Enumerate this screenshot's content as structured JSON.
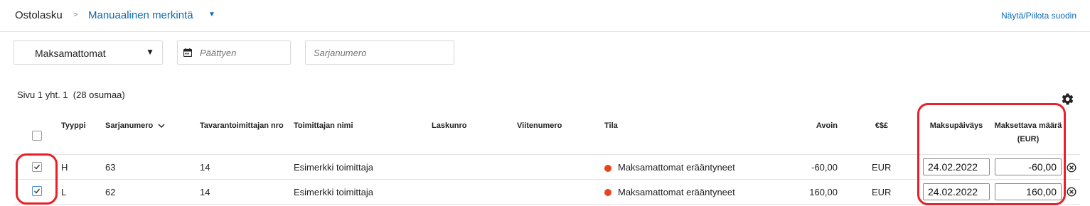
{
  "breadcrumb": {
    "root": "Ostolasku",
    "separator": ">",
    "current": "Manuaalinen merkintä"
  },
  "toggle_filter_label": "Näytä/Piilota suodin",
  "filters": {
    "status_value": "Maksamattomat",
    "end_date_placeholder": "Päättyen",
    "serial_placeholder": "Sarjanumero"
  },
  "page_info": "Sivu 1 yht. 1  (28 osumaa)",
  "columns": {
    "type": "Tyyppi",
    "serial": "Sarjanumero",
    "supplier_nr": "Tavarantoimittajan nro",
    "supplier_name": "Toimittajan nimi",
    "invoice_nr": "Laskunro",
    "reference": "Viitenumero",
    "status": "Tila",
    "open": "Avoin",
    "currency": "€$£",
    "pay_date": "Maksupäiväys",
    "pay_amount_line1": "Maksettava määrä",
    "pay_amount_line2": "(EUR)"
  },
  "rows": [
    {
      "checked": true,
      "type": "H",
      "serial": "63",
      "supplier_nr": "14",
      "supplier_name": "Esimerkki toimittaja",
      "status": "Maksamattomat erääntyneet",
      "open": "-60,00",
      "currency": "EUR",
      "pay_date": "24.02.2022",
      "pay_amount": "-60,00"
    },
    {
      "checked": true,
      "type": "L",
      "serial": "62",
      "supplier_nr": "14",
      "supplier_name": "Esimerkki toimittaja",
      "status": "Maksamattomat erääntyneet",
      "open": "160,00",
      "currency": "EUR",
      "pay_date": "24.02.2022",
      "pay_amount": "160,00"
    }
  ],
  "colors": {
    "accent": "#0a6ab5",
    "status_overdue": "#e8441c",
    "annotation": "#e8202a"
  }
}
